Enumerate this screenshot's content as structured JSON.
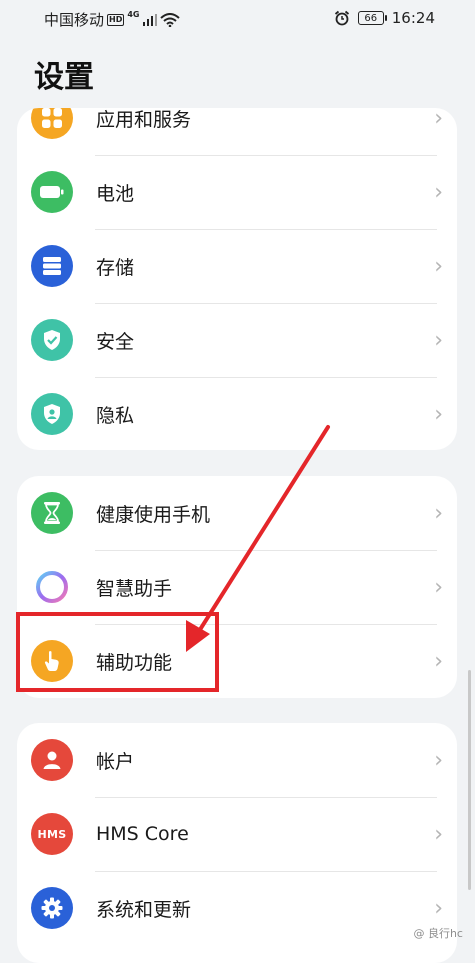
{
  "status_bar": {
    "carrier": "中国移动",
    "hd": "HD",
    "network": "4G",
    "battery": "66",
    "time": "16:24"
  },
  "page": {
    "title": "设置"
  },
  "groups": [
    {
      "items": [
        {
          "label": "应用和服务",
          "icon": "apps-icon",
          "color": "#f5a623"
        },
        {
          "label": "电池",
          "icon": "battery-icon",
          "color": "#3dbd63"
        },
        {
          "label": "存储",
          "icon": "storage-icon",
          "color": "#2a61d8"
        },
        {
          "label": "安全",
          "icon": "shield-check-icon",
          "color": "#3fc3a7"
        },
        {
          "label": "隐私",
          "icon": "privacy-shield-icon",
          "color": "#3fc3a7"
        }
      ]
    },
    {
      "items": [
        {
          "label": "健康使用手机",
          "icon": "hourglass-icon",
          "color": "#3dbd63"
        },
        {
          "label": "智慧助手",
          "icon": "smart-assistant-icon",
          "color": "#9b6cf0"
        },
        {
          "label": "辅助功能",
          "icon": "hand-pointer-icon",
          "color": "#f5a623"
        }
      ]
    },
    {
      "items": [
        {
          "label": "帐户",
          "icon": "user-icon",
          "color": "#e5483b"
        },
        {
          "label": "HMS Core",
          "icon": "hms-icon",
          "color": "#e5483b",
          "badge_text": "HMS"
        },
        {
          "label": "系统和更新",
          "icon": "gear-icon",
          "color": "#2a61d8"
        }
      ]
    }
  ],
  "annotation": {
    "highlight_color": "#e4262a"
  },
  "watermark": "@ 良行hc"
}
